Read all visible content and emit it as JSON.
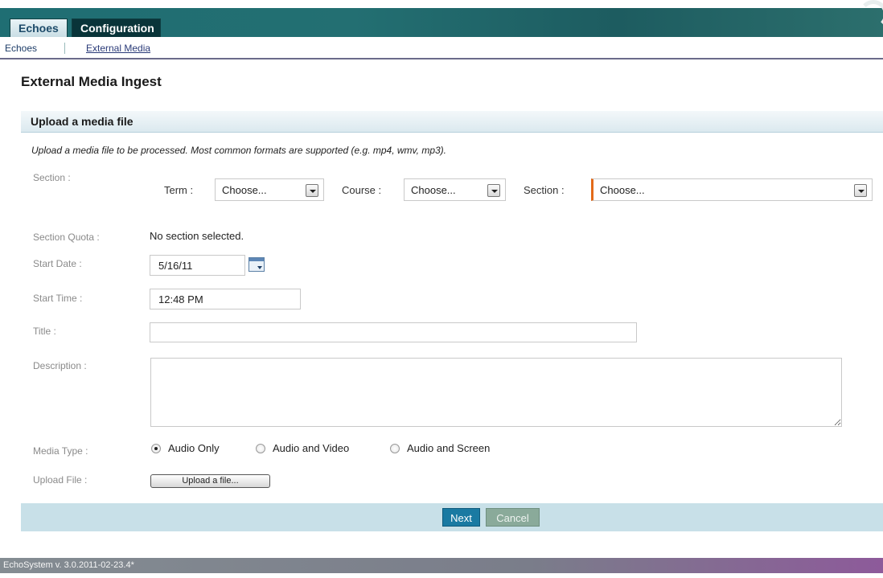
{
  "tabs": [
    {
      "label": "Echoes"
    },
    {
      "label": "Configuration"
    }
  ],
  "subnav": {
    "items": [
      {
        "label": "Echoes"
      },
      {
        "label": "External Media"
      }
    ]
  },
  "page": {
    "title": "External Media Ingest"
  },
  "panel": {
    "title": "Upload a media file",
    "intro": "Upload a media file to be processed. Most common formats are supported (e.g. mp4, wmv, mp3)."
  },
  "form": {
    "section_label": "Section :",
    "term_label": "Term :",
    "term_value": "Choose...",
    "course_label": "Course :",
    "course_value": "Choose...",
    "section_inline_label": "Section :",
    "section_value": "Choose...",
    "quota_label": "Section Quota :",
    "quota_value": "No section selected.",
    "start_date_label": "Start Date :",
    "start_date_value": "5/16/11",
    "start_time_label": "Start Time :",
    "start_time_value": "12:48 PM",
    "title_label": "Title :",
    "title_value": "",
    "description_label": "Description :",
    "media_type_label": "Media Type :",
    "media_types": [
      {
        "label": "Audio Only",
        "selected": true
      },
      {
        "label": "Audio and Video",
        "selected": false
      },
      {
        "label": "Audio and Screen",
        "selected": false
      }
    ],
    "upload_label": "Upload File :",
    "upload_button": "Upload a file..."
  },
  "actions": {
    "next": "Next",
    "cancel": "Cancel"
  },
  "footer": {
    "version": "EchoSystem v. 3.0.2011-02-23.4*"
  },
  "colors": {
    "header": "#1f6e73",
    "accent_required": "#e36a1a",
    "next_button": "#1a7aa2"
  }
}
